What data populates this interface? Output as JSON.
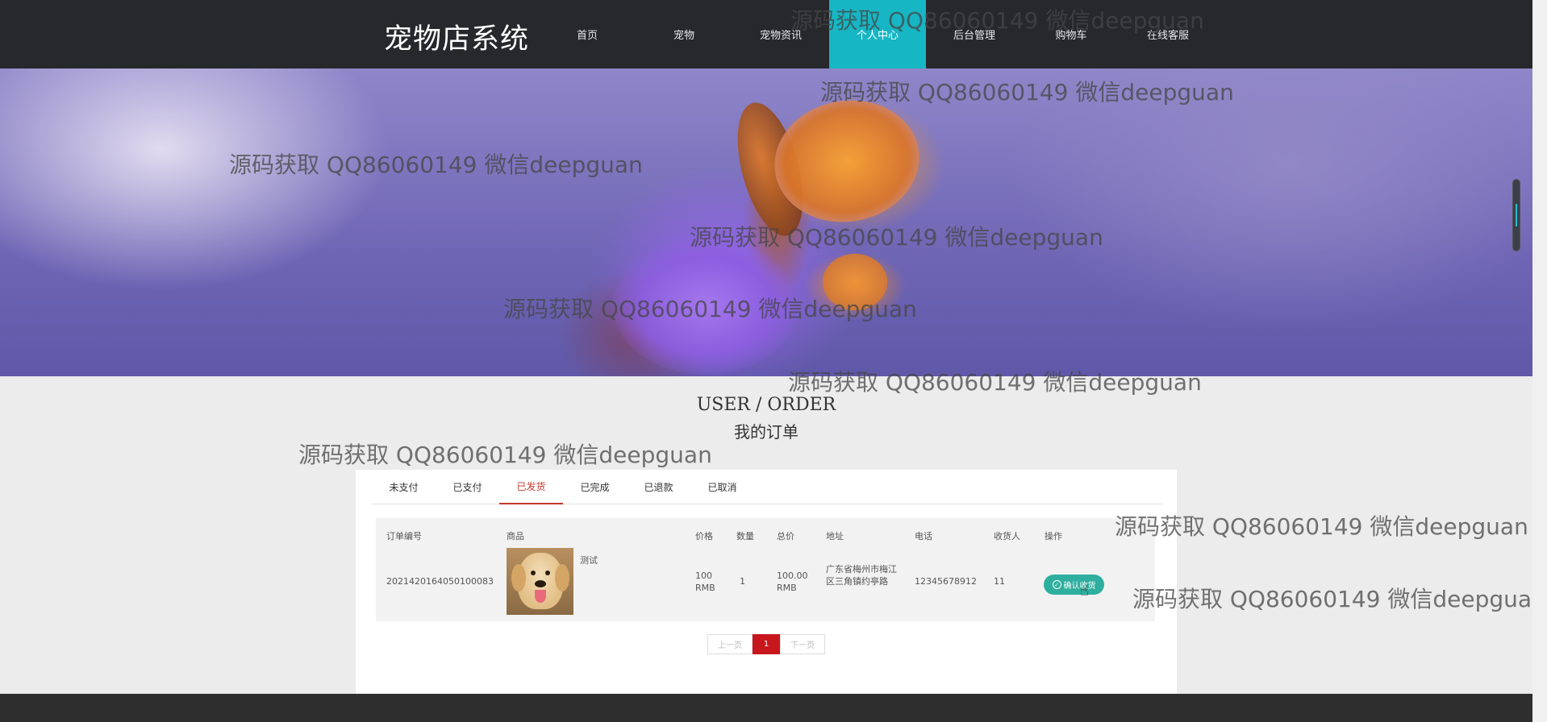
{
  "header": {
    "logo": "宠物店系统",
    "nav": [
      {
        "label": "首页"
      },
      {
        "label": "宠物"
      },
      {
        "label": "宠物资讯"
      },
      {
        "label": "个人中心"
      },
      {
        "label": "后台管理"
      },
      {
        "label": "购物车"
      },
      {
        "label": "在线客服"
      }
    ],
    "active_index": 3,
    "active_color": "#17b6c4"
  },
  "section": {
    "title_en": "USER / ORDER",
    "title_zh": "我的订单"
  },
  "tabs": [
    {
      "label": "未支付"
    },
    {
      "label": "已支付"
    },
    {
      "label": "已发货"
    },
    {
      "label": "已完成"
    },
    {
      "label": "已退款"
    },
    {
      "label": "已取消"
    }
  ],
  "active_tab": "已发货",
  "table": {
    "columns": [
      "订单编号",
      "商品",
      "价格",
      "数量",
      "总价",
      "地址",
      "电话",
      "收货人",
      "操作"
    ],
    "rows": [
      {
        "order_no": "2021420164050100083",
        "goods_name": "测试",
        "price": "100 RMB",
        "quantity": "1",
        "total": "100.00 RMB",
        "address": "广东省梅州市梅江区三角镇约亭路",
        "phone": "12345678912",
        "receiver": "11",
        "action": "确认收货"
      }
    ]
  },
  "pager": {
    "prev": "上一页",
    "current": "1",
    "next": "下一页"
  },
  "watermark": "源码获取 QQ86060149 微信deepguan",
  "colors": {
    "header_bg": "#26282c",
    "accent": "#17b6c4",
    "active_tab": "#c0392b",
    "action_button": "#2eaf9f",
    "pager_active": "#c8161d"
  },
  "icons": {
    "confirm": "check-circle-icon",
    "cursor": "hand-cursor-icon"
  }
}
